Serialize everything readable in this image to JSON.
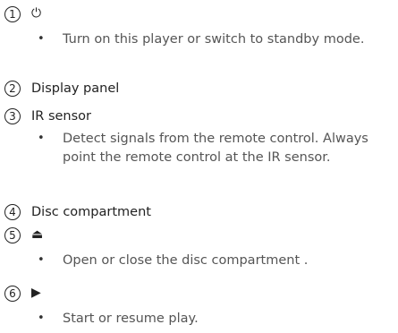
{
  "items": [
    {
      "number": "1",
      "symbol": "⏻",
      "description": "Turn on this player or switch to standby mode."
    },
    {
      "number": "2",
      "title": "Display panel"
    },
    {
      "number": "3",
      "title": "IR sensor",
      "description": "Detect signals from the remote control. Always point the remote control at the IR sensor."
    },
    {
      "number": "4",
      "title": "Disc compartment"
    },
    {
      "number": "5",
      "symbol": "⏏",
      "description": "Open or close the disc compartment ."
    },
    {
      "number": "6",
      "symbol": "▶",
      "description": "Start or resume play."
    }
  ],
  "bullet": "•"
}
